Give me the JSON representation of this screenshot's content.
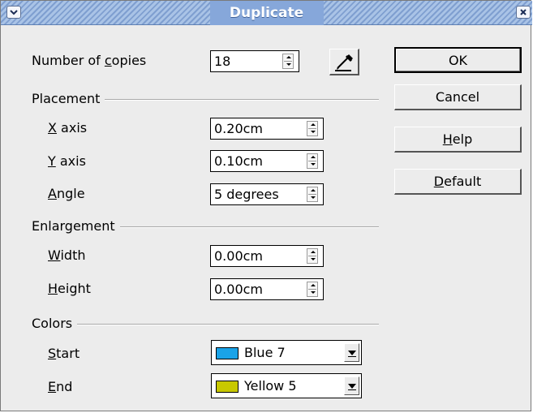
{
  "window": {
    "title": "Duplicate"
  },
  "copies": {
    "label_pre": "Number of ",
    "label_u": "c",
    "label_post": "opies",
    "value": "18"
  },
  "placement": {
    "heading": "Placement",
    "x_axis": {
      "label_u": "X",
      "label_post": " axis",
      "value": "0.20cm"
    },
    "y_axis": {
      "label_u": "Y",
      "label_post": " axis",
      "value": "0.10cm"
    },
    "angle": {
      "label_u": "A",
      "label_post": "ngle",
      "value": "5 degrees"
    }
  },
  "enlargement": {
    "heading": "Enlargement",
    "width": {
      "label_u": "W",
      "label_post": "idth",
      "value": "0.00cm"
    },
    "height": {
      "label_u": "H",
      "label_post": "eight",
      "value": "0.00cm"
    }
  },
  "colors": {
    "heading": "Colors",
    "start": {
      "label_u": "S",
      "label_post": "tart",
      "value": "Blue 7",
      "swatch": "#1aa3e8"
    },
    "end": {
      "label_u": "E",
      "label_post": "nd",
      "value": "Yellow 5",
      "swatch": "#c8c800"
    }
  },
  "buttons": {
    "ok": "OK",
    "cancel": "Cancel",
    "help": {
      "label_u": "H",
      "label_post": "elp"
    },
    "default": {
      "label_u": "D",
      "label_post": "efault"
    }
  },
  "icons": {
    "menu": "chevron-down-icon",
    "close": "close-icon",
    "picker": "pipette-icon"
  }
}
